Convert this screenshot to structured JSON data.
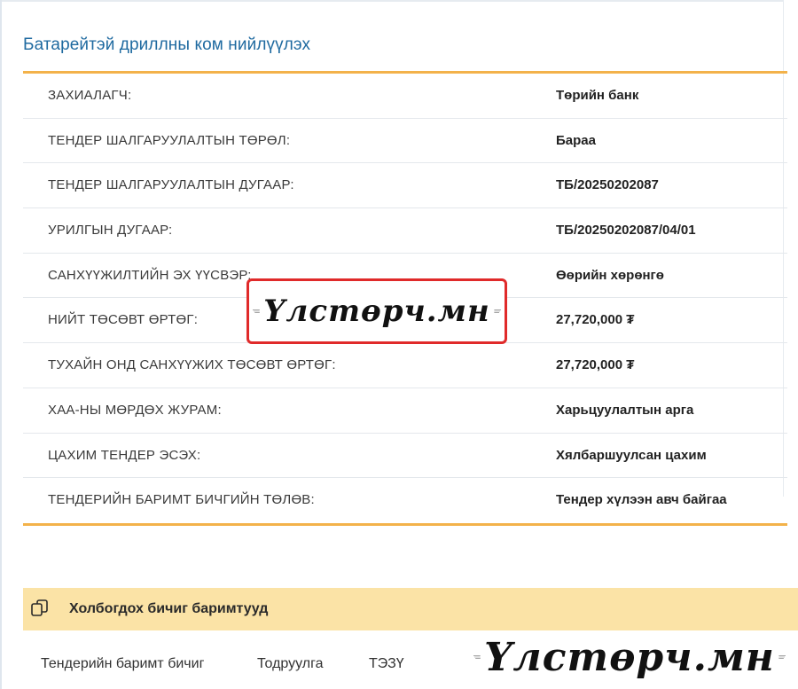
{
  "page": {
    "title": "Батарейтэй дриллны ком нийлүүлэх"
  },
  "details": [
    {
      "label": "ЗАХИАЛАГЧ:",
      "value": "Төрийн банк"
    },
    {
      "label": "ТЕНДЕР ШАЛГАРУУЛАЛТЫН ТӨРӨЛ:",
      "value": "Бараа"
    },
    {
      "label": "ТЕНДЕР ШАЛГАРУУЛАЛТЫН ДУГААР:",
      "value": "ТБ/20250202087"
    },
    {
      "label": "УРИЛГЫН ДУГААР:",
      "value": "ТБ/20250202087/04/01"
    },
    {
      "label": "САНХҮҮЖИЛТИЙН ЭХ ҮҮСВЭР:",
      "value": "Өөрийн хөрөнгө"
    },
    {
      "label": "НИЙТ ТӨСӨВТ ӨРТӨГ:",
      "value": "27,720,000 ₮"
    },
    {
      "label": "ТУХАЙН ОНД САНХҮҮЖИХ ТӨСӨВТ ӨРТӨГ:",
      "value": "27,720,000 ₮"
    },
    {
      "label": "ХАА-НЫ МӨРДӨХ ЖУРАМ:",
      "value": "Харьцуулалтын арга"
    },
    {
      "label": "ЦАХИМ ТЕНДЕР ЭСЭХ:",
      "value": "Хялбаршуулсан цахим"
    },
    {
      "label": "ТЕНДЕРИЙН БАРИМТ БИЧГИЙН ТӨЛӨВ:",
      "value": "Тендер хүлээн авч байгаа"
    }
  ],
  "documents": {
    "header_title": "Холбогдох бичиг баримтууд",
    "header_icon": "copy-documents-icon",
    "tabs": [
      "Тендерийн баримт бичиг",
      "Тодруулга",
      "ТЭЗҮ"
    ]
  },
  "watermark": {
    "text": "Үлстөрч.мн"
  },
  "colors": {
    "title": "#1f6aa0",
    "accent_line": "#f3b24a",
    "docs_header_bg": "#fbe3a6",
    "watermark_border": "#e02a2a"
  }
}
